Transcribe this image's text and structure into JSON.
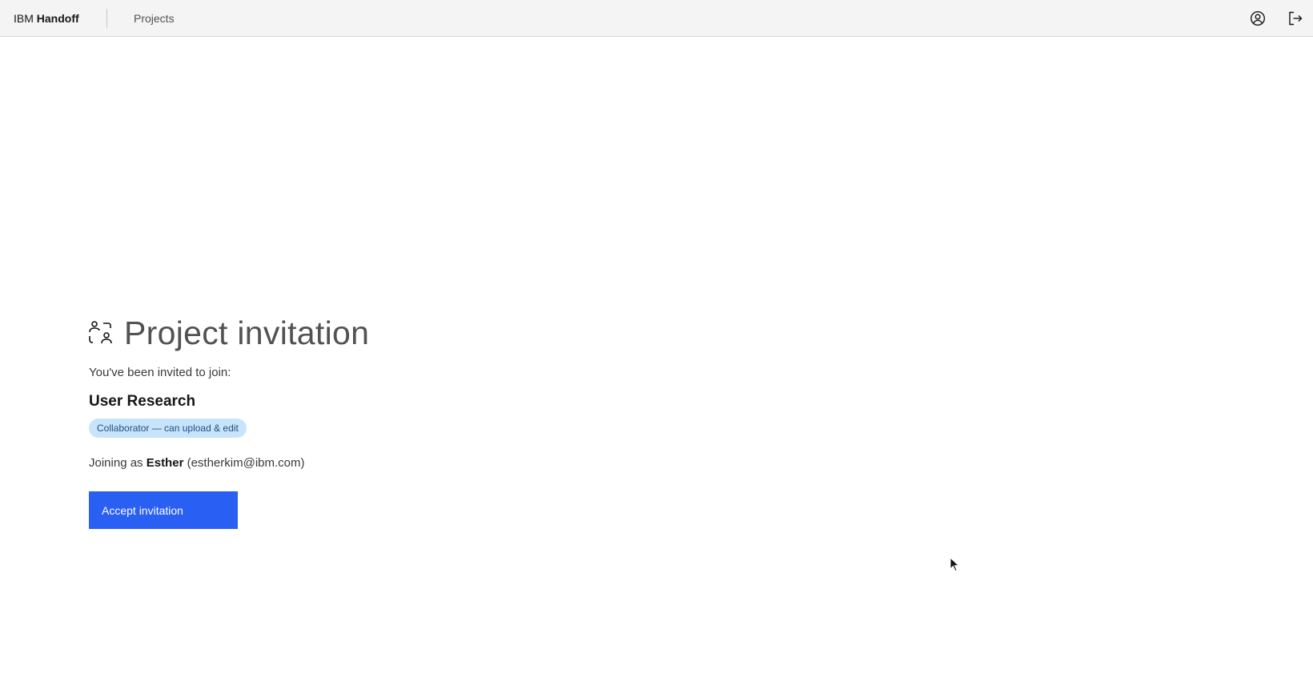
{
  "header": {
    "brand_prefix": "IBM",
    "brand_name": "Handoff",
    "nav_projects": "Projects",
    "icons": [
      "user-avatar-icon",
      "logout-icon"
    ]
  },
  "invitation": {
    "title": "Project invitation",
    "title_icon": "group-invite-icon",
    "intro": "You've been invited to join:",
    "project_name": "User Research",
    "role_tag": "Collaborator — can upload & edit",
    "joining_prefix": "Joining as",
    "user_name": "Esther",
    "user_email": "(estherkim@ibm.com)",
    "accept_label": "Accept invitation"
  },
  "colors": {
    "primary_button": "#2a5ff3",
    "tag_background": "#c7e4fb",
    "tag_text": "#1e4f84",
    "header_background": "#f4f4f4"
  }
}
